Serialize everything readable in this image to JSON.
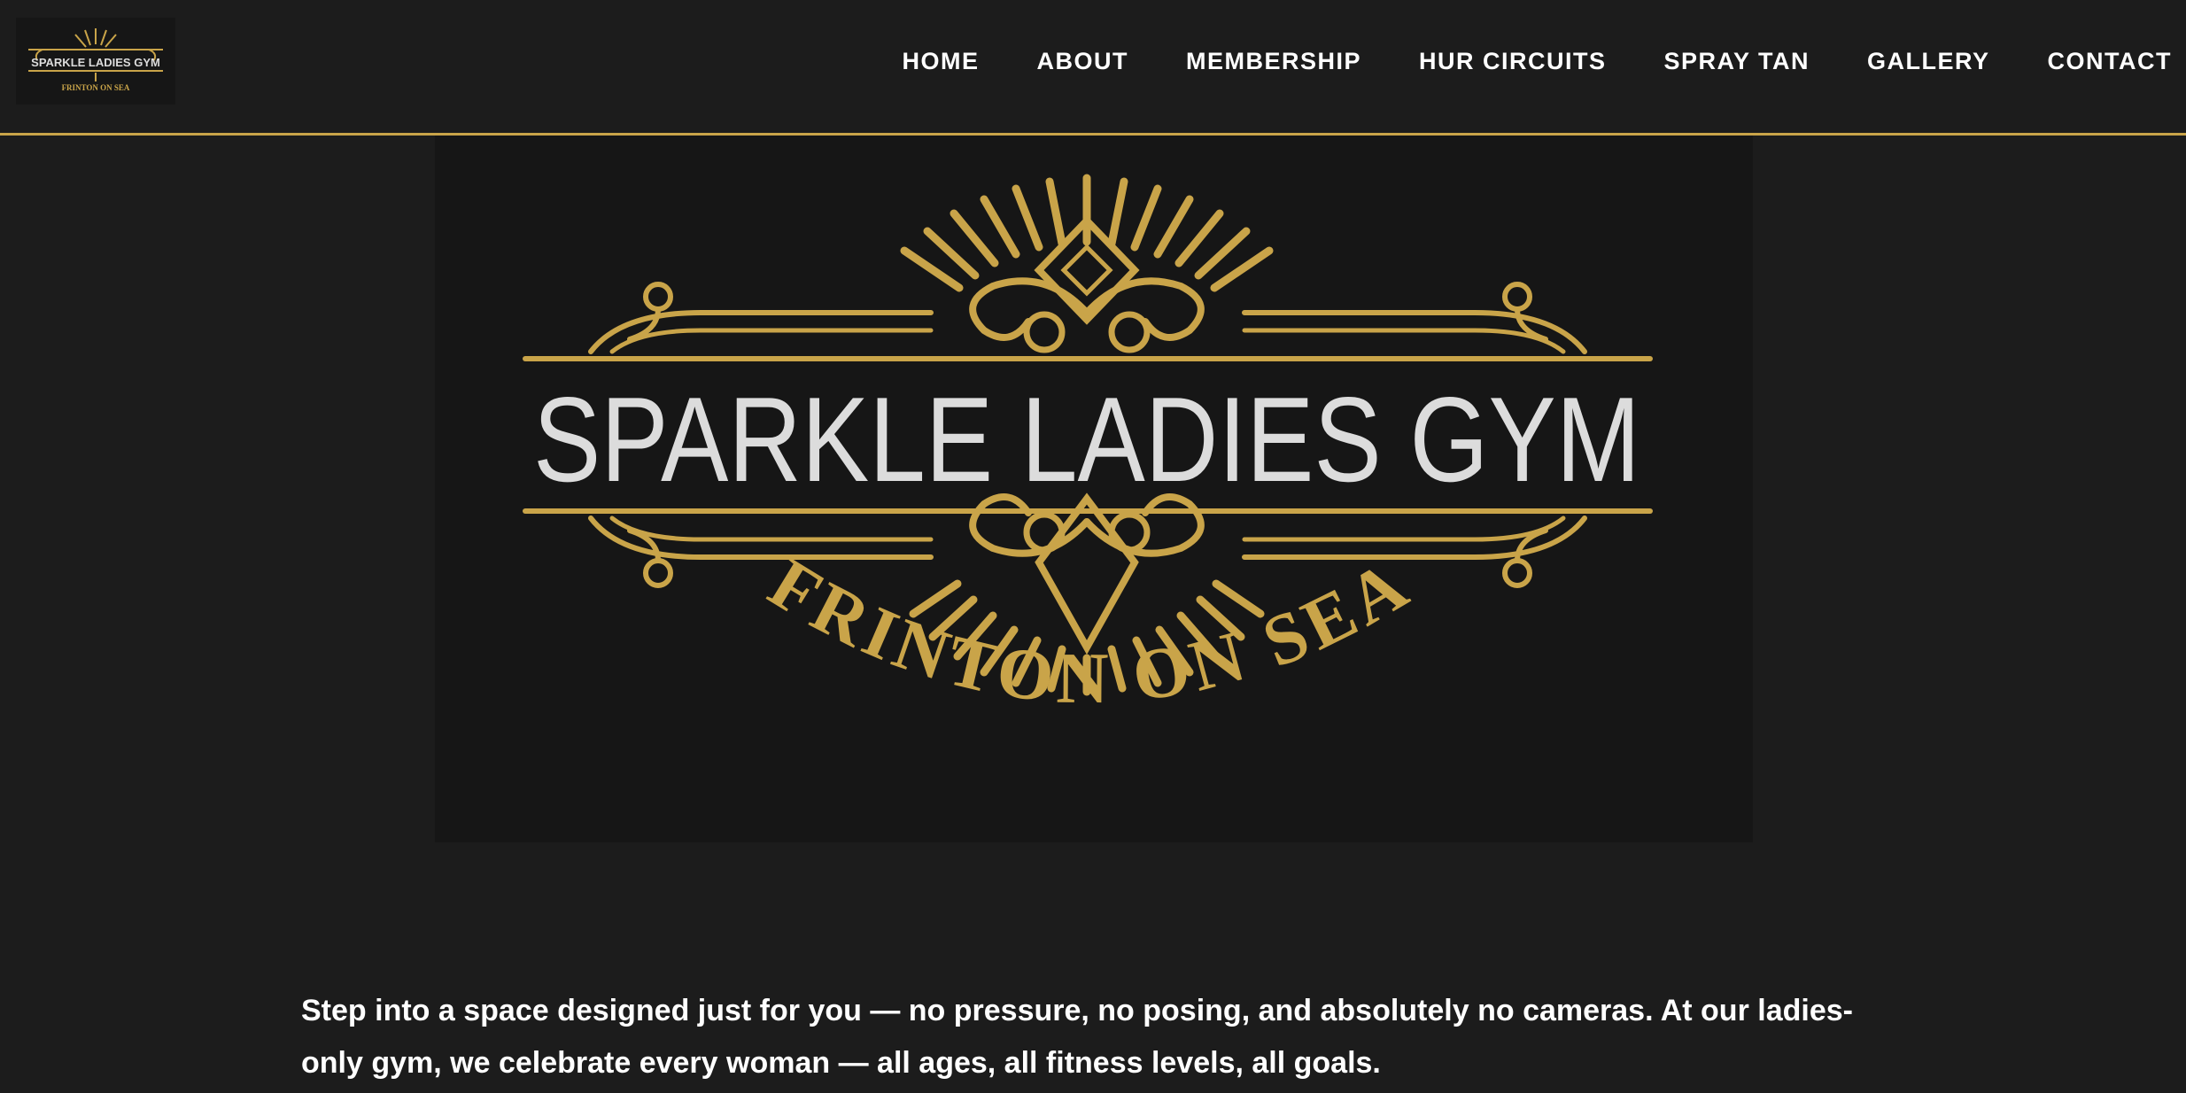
{
  "brand": {
    "name": "SPARKLE LADIES GYM",
    "location": "FRINTON ON SEA",
    "gold": "#c9a449",
    "text_light": "#dcdcdc"
  },
  "nav": {
    "items": [
      {
        "label": "HOME"
      },
      {
        "label": "ABOUT"
      },
      {
        "label": "MEMBERSHIP"
      },
      {
        "label": "HUR CIRCUITS"
      },
      {
        "label": "SPRAY TAN"
      },
      {
        "label": "GALLERY"
      },
      {
        "label": "CONTACT"
      }
    ]
  },
  "intro": {
    "text": "Step into a space designed just for you — no pressure, no posing, and absolutely no cameras. At our ladies-only gym, we celebrate every woman — all ages, all fitness levels, all goals."
  }
}
